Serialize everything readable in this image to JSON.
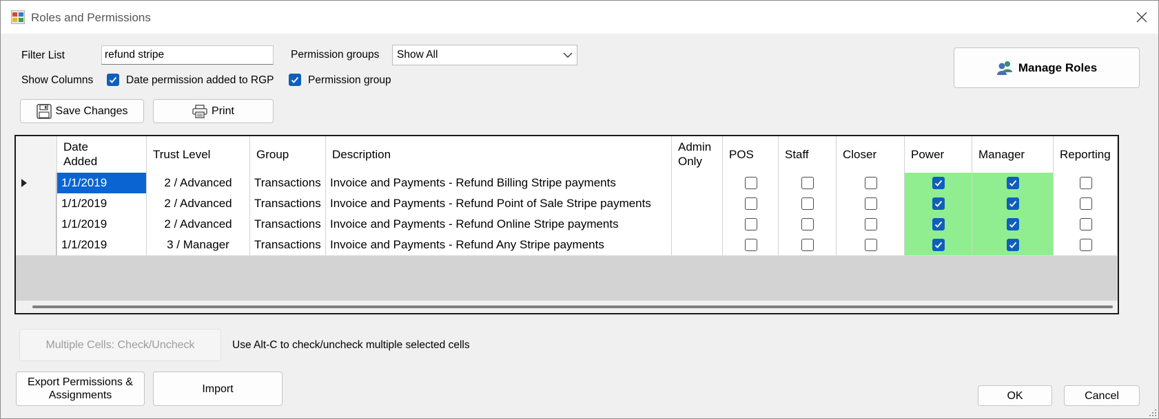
{
  "window": {
    "title": "Roles and Permissions"
  },
  "filter": {
    "label": "Filter List",
    "value": "refund stripe"
  },
  "permission_groups": {
    "label": "Permission groups",
    "selected": "Show All"
  },
  "show_columns": {
    "label": "Show Columns",
    "date_added": {
      "label": "Date permission added to RGP",
      "checked": true
    },
    "permission_group": {
      "label": "Permission group",
      "checked": true
    }
  },
  "buttons": {
    "manage_roles": "Manage Roles",
    "save_changes": "Save Changes",
    "print": "Print",
    "multiple_cells": "Multiple Cells:  Check/Uncheck",
    "export": "Export Permissions & Assignments",
    "import": "Import",
    "ok": "OK",
    "cancel": "Cancel"
  },
  "hint": "Use Alt-C to check/uncheck multiple selected cells",
  "grid": {
    "columns": {
      "date_added": [
        "Date",
        "Added"
      ],
      "trust_level": "Trust Level",
      "group": "Group",
      "description": "Description",
      "admin_only": [
        "Admin",
        "Only"
      ],
      "pos": "POS",
      "staff": "Staff",
      "closer": "Closer",
      "power": "Power",
      "manager": "Manager",
      "reporting": "Reporting"
    },
    "rows": [
      {
        "date": "1/1/2019",
        "trust": "2 / Advanced",
        "group": "Transactions",
        "description": "Invoice and Payments - Refund Billing Stripe payments",
        "pos": false,
        "staff": false,
        "closer": false,
        "power": true,
        "manager": true,
        "reporting": false
      },
      {
        "date": "1/1/2019",
        "trust": "2 / Advanced",
        "group": "Transactions",
        "description": "Invoice and Payments - Refund Point of Sale Stripe payments",
        "pos": false,
        "staff": false,
        "closer": false,
        "power": true,
        "manager": true,
        "reporting": false
      },
      {
        "date": "1/1/2019",
        "trust": "2 / Advanced",
        "group": "Transactions",
        "description": "Invoice and Payments - Refund Online Stripe payments",
        "pos": false,
        "staff": false,
        "closer": false,
        "power": true,
        "manager": true,
        "reporting": false
      },
      {
        "date": "1/1/2019",
        "trust": "3 / Manager",
        "group": "Transactions",
        "description": "Invoice and Payments - Refund Any Stripe payments",
        "pos": false,
        "staff": false,
        "closer": false,
        "power": true,
        "manager": true,
        "reporting": false
      }
    ]
  },
  "colors": {
    "accent": "#0f5fba",
    "selection": "#0a64d2",
    "granted": "#90ee90"
  }
}
